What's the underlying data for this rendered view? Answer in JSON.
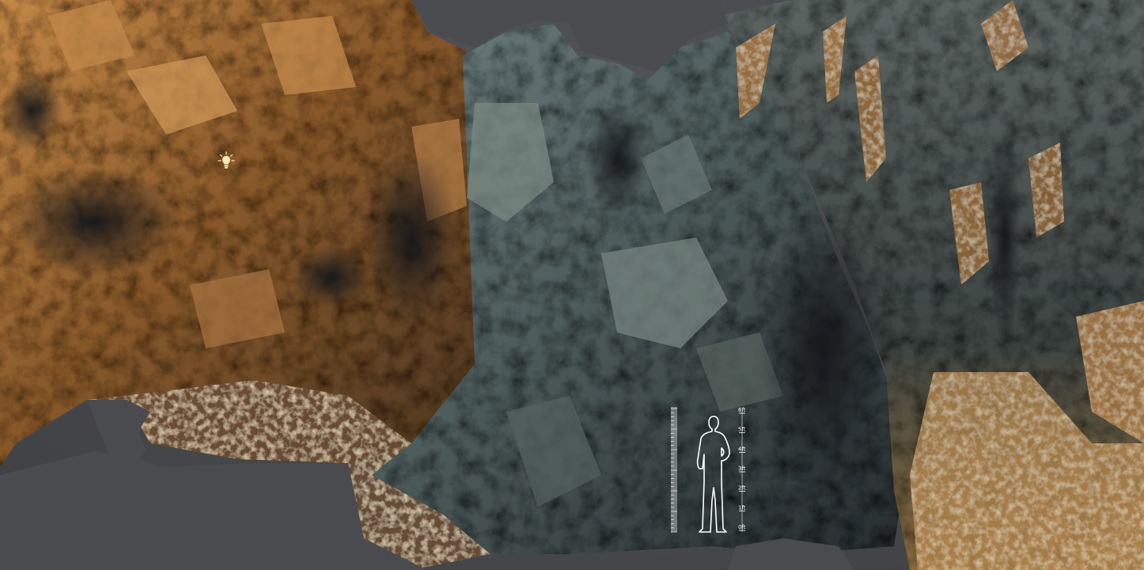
{
  "viewport": {
    "background_color": "#4a4b4f",
    "subject": "photoscanned rock cliff"
  },
  "icons": {
    "light": "light-bulb-icon",
    "scale": "human-scale-figure-icon"
  },
  "colors": {
    "warm_rock": "#b0763a",
    "cool_rock": "#4c5a60",
    "dark_shadow": "#1c1e22"
  },
  "scale_reference": {
    "feet_labels": [
      "6ft",
      "5ft",
      "4ft",
      "3ft",
      "2ft",
      "1ft",
      "0ft"
    ]
  }
}
